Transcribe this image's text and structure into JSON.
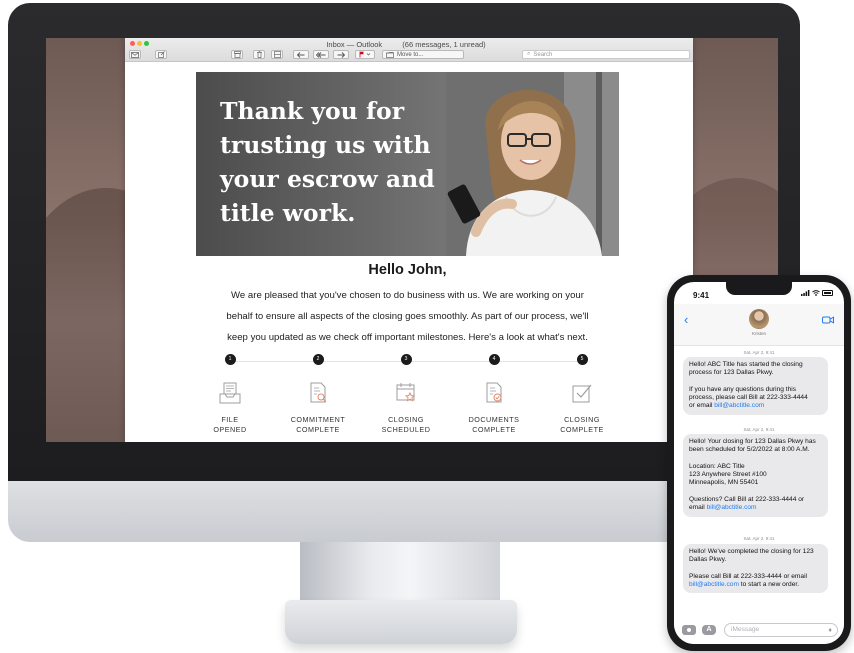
{
  "outlook": {
    "window_title": "Inbox — Outlook",
    "message_count": "(66 messages, 1 unread)",
    "toolbar": {
      "move_to_label": "Move to...",
      "search_placeholder": "Search"
    }
  },
  "email": {
    "hero_lines": [
      "Thank you for",
      "trusting us with",
      "your escrow and",
      "title work."
    ],
    "greeting": "Hello John,",
    "intro_lines": [
      "We are pleased that you've chosen to do business with us. We are working on your",
      "behalf to ensure all aspects of the closing goes smoothly. As part of our process, we'll",
      "keep you updated as we check off important milestones. Here's a look at what's next."
    ],
    "steps": [
      {
        "number": "1",
        "line1": "FILE",
        "line2": "OPENED",
        "icon": "inbox-icon"
      },
      {
        "number": "2",
        "line1": "COMMITMENT",
        "line2": "COMPLETE",
        "icon": "document-search-icon"
      },
      {
        "number": "3",
        "line1": "CLOSING",
        "line2": "SCHEDULED",
        "icon": "calendar-star-icon"
      },
      {
        "number": "4",
        "line1": "DOCUMENTS",
        "line2": "COMPLETE",
        "icon": "document-check-icon"
      },
      {
        "number": "5",
        "line1": "CLOSING",
        "line2": "COMPLETE",
        "icon": "checkbox-icon"
      }
    ]
  },
  "phone": {
    "status_time": "9:41",
    "contact_name": "Kristen",
    "messages": [
      {
        "timestamp": "Sat, Apr 2, 9:41",
        "lines": [
          "Hello! ABC Title has started the closing",
          "process for 123 Dallas Pkwy.",
          "",
          "If you have any questions during this",
          "process, please call Bill at 222-333-4444",
          "or email |bill@abctitle.com"
        ]
      },
      {
        "timestamp": "Sat, Apr 2, 9:41",
        "lines": [
          "Hello! Your closing for 123 Dallas Pkwy has",
          "been scheduled for 5/2/2022 at 8:00 A.M.",
          "",
          "Location: ABC Title",
          "123 Anywhere Street #100",
          "Minneapolis, MN 55401",
          "",
          "Questions? Call Bill at 222-333-4444 or",
          "email |bill@abctitle.com"
        ]
      },
      {
        "timestamp": "Sat, Apr 2, 9:41",
        "lines": [
          "Hello! We've completed the closing for 123",
          "Dallas Pkwy.",
          "",
          "Please call Bill at 222-333-4444 or email",
          "|bill@abctitle.com| to start a new order."
        ]
      }
    ],
    "composer_placeholder": "iMessage"
  },
  "colors": {
    "link": "#1e7cf2",
    "bubble": "#e9e9eb",
    "step_dot": "#1b1b1b",
    "icon_stroke": "#9d9d9d"
  }
}
